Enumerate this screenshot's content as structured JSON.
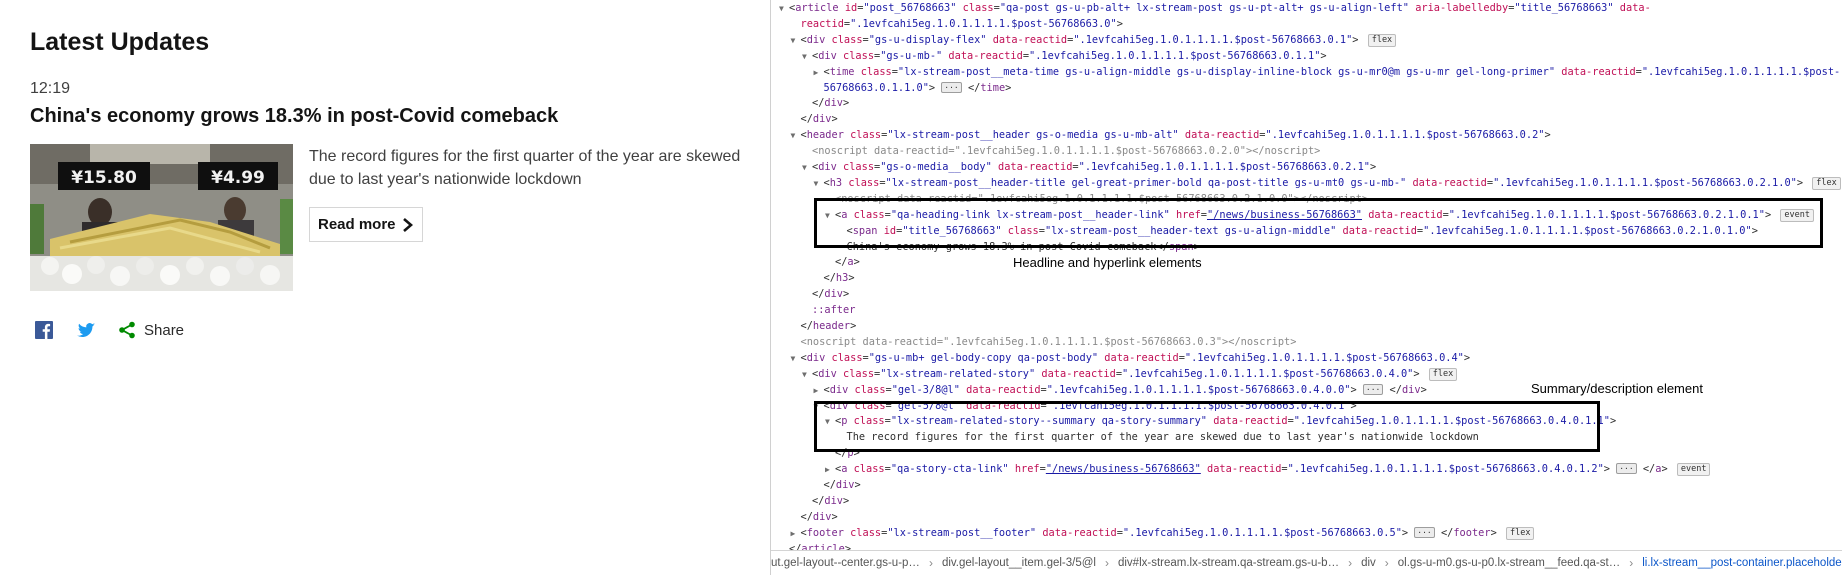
{
  "post": {
    "section_title": "Latest Updates",
    "time": "12:19",
    "headline": "China's economy grows 18.3% in post-Covid comeback",
    "summary": "The record figures for the first quarter of the year are skewed due to last year's nationwide lockdown",
    "read_more": "Read more",
    "image_signs": [
      "¥15.80",
      "¥4.99"
    ],
    "share": {
      "facebook_icon": "facebook-icon",
      "twitter_icon": "twitter-icon",
      "share_icon": "share-icon",
      "share_label": "Share"
    },
    "colors": {
      "facebook": "#3b5998",
      "twitter": "#1d9bf0",
      "share": "#008a00",
      "text": "#141414"
    }
  },
  "devtools": {
    "lines": [
      {
        "indent": 0,
        "tri": "open",
        "html": "&lt;<span class='tag'>article</span> <span class='an'>id</span>=<span class='av'>\"post_56768663\"</span> <span class='an'>class</span>=<span class='av'>\"qa-post gs-u-pb-alt+ lx-stream-post gs-u-pt-alt+ gs-u-align-left\"</span> <span class='an'>aria-labelledby</span>=<span class='av'>\"title_56768663\"</span> <span class='an'>data-</span>"
      },
      {
        "indent": 1,
        "tri": "none",
        "html": "<span class='an'>reactid</span>=<span class='av'>\".1evfcahi5eg.1.0.1.1.1.1.$post-56768663.0\"</span>&gt;"
      },
      {
        "indent": 1,
        "tri": "open",
        "html": "&lt;<span class='tag'>div</span> <span class='an'>class</span>=<span class='av'>\"gs-u-display-flex\"</span> <span class='an'>data-reactid</span>=<span class='av'>\".1evfcahi5eg.1.0.1.1.1.1.$post-56768663.0.1\"</span>&gt; <span class='badge'>flex</span>"
      },
      {
        "indent": 2,
        "tri": "open",
        "html": "&lt;<span class='tag'>div</span> <span class='an'>class</span>=<span class='av'>\"gs-u-mb-\"</span> <span class='an'>data-reactid</span>=<span class='av'>\".1evfcahi5eg.1.0.1.1.1.1.$post-56768663.0.1.1\"</span>&gt;"
      },
      {
        "indent": 3,
        "tri": "closed",
        "html": "&lt;<span class='tag'>time</span> <span class='an'>class</span>=<span class='av'>\"lx-stream-post__meta-time gs-u-align-middle gs-u-display-inline-block gs-u-mr0@m gs-u-mr gel-long-primer\"</span> <span class='an'>data-reactid</span>=<span class='av'>\".1evfcahi5eg.1.0.1.1.1.1.$post-</span>"
      },
      {
        "indent": 3,
        "tri": "none",
        "html": "<span class='av'>56768663.0.1.1.0\"</span>&gt; <span class='ell'>···</span> &lt;/<span class='tag'>time</span>&gt;"
      },
      {
        "indent": 2,
        "tri": "none",
        "html": "&lt;/<span class='tag'>div</span>&gt;"
      },
      {
        "indent": 1,
        "tri": "none",
        "html": "&lt;/<span class='tag'>div</span>&gt;"
      },
      {
        "indent": 1,
        "tri": "open",
        "html": "&lt;<span class='tag'>header</span> <span class='an'>class</span>=<span class='av'>\"lx-stream-post__header gs-o-media gs-u-mb-alt\"</span> <span class='an'>data-reactid</span>=<span class='av'>\".1evfcahi5eg.1.0.1.1.1.1.$post-56768663.0.2\"</span>&gt;"
      },
      {
        "indent": 2,
        "tri": "none",
        "html": "<span class='cm'>&lt;noscript data-reactid=\".1evfcahi5eg.1.0.1.1.1.1.$post-56768663.0.2.0\"&gt;&lt;/noscript&gt;</span>"
      },
      {
        "indent": 2,
        "tri": "open",
        "html": "&lt;<span class='tag'>div</span> <span class='an'>class</span>=<span class='av'>\"gs-o-media__body\"</span> <span class='an'>data-reactid</span>=<span class='av'>\".1evfcahi5eg.1.0.1.1.1.1.$post-56768663.0.2.1\"</span>&gt;"
      },
      {
        "indent": 3,
        "tri": "open",
        "html": "&lt;<span class='tag'>h3</span> <span class='an'>class</span>=<span class='av'>\"lx-stream-post__header-title gel-great-primer-bold qa-post-title gs-u-mt0 gs-u-mb-\"</span> <span class='an'>data-reactid</span>=<span class='av'>\".1evfcahi5eg.1.0.1.1.1.1.$post-56768663.0.2.1.0\"</span>&gt; <span class='badge'>flex</span>"
      },
      {
        "indent": 4,
        "tri": "none",
        "html": "<span class='cm'>&lt;noscript data-reactid=\".1evfcahi5eg.1.0.1.1.1.1.$post-56768663.0.2.1.0.0\"&gt;&lt;/noscript&gt;</span>"
      },
      {
        "indent": 4,
        "tri": "open",
        "html": "&lt;<span class='tag'>a</span> <span class='an'>class</span>=<span class='av'>\"qa-heading-link lx-stream-post__header-link\"</span> <span class='an'>href</span>=<span class='av lnk'>\"/news/business-56768663\"</span> <span class='an'>data-reactid</span>=<span class='av'>\".1evfcahi5eg.1.0.1.1.1.1.$post-56768663.0.2.1.0.1\"</span>&gt; <span class='badge'>event</span>"
      },
      {
        "indent": 5,
        "tri": "none",
        "html": "&lt;<span class='tag'>span</span> <span class='an'>id</span>=<span class='av'>\"title_56768663\"</span> <span class='an'>class</span>=<span class='av'>\"lx-stream-post__header-text gs-u-align-middle\"</span> <span class='an'>data-reactid</span>=<span class='av'>\".1evfcahi5eg.1.0.1.1.1.1.$post-56768663.0.2.1.0.1.0\"</span>&gt;"
      },
      {
        "indent": 5,
        "tri": "none",
        "html": "<span class='tx'>China's economy grows 18.3% in post-Covid comeback</span>&lt;/<span class='tag'>span</span>&gt;"
      },
      {
        "indent": 4,
        "tri": "none",
        "html": "&lt;/<span class='tag'>a</span>&gt;"
      },
      {
        "indent": 3,
        "tri": "none",
        "html": "&lt;/<span class='tag'>h3</span>&gt;"
      },
      {
        "indent": 2,
        "tri": "none",
        "html": "&lt;/<span class='tag'>div</span>&gt;"
      },
      {
        "indent": 2,
        "tri": "none",
        "html": "<span class='tag'>::after</span>"
      },
      {
        "indent": 1,
        "tri": "none",
        "html": "&lt;/<span class='tag'>header</span>&gt;"
      },
      {
        "indent": 1,
        "tri": "none",
        "html": "<span class='cm'>&lt;noscript data-reactid=\".1evfcahi5eg.1.0.1.1.1.1.$post-56768663.0.3\"&gt;&lt;/noscript&gt;</span>"
      },
      {
        "indent": 1,
        "tri": "open",
        "html": "&lt;<span class='tag'>div</span> <span class='an'>class</span>=<span class='av'>\"gs-u-mb+ gel-body-copy qa-post-body\"</span> <span class='an'>data-reactid</span>=<span class='av'>\".1evfcahi5eg.1.0.1.1.1.1.$post-56768663.0.4\"</span>&gt;"
      },
      {
        "indent": 2,
        "tri": "open",
        "html": "&lt;<span class='tag'>div</span> <span class='an'>class</span>=<span class='av'>\"lx-stream-related-story\"</span> <span class='an'>data-reactid</span>=<span class='av'>\".1evfcahi5eg.1.0.1.1.1.1.$post-56768663.0.4.0\"</span>&gt; <span class='badge'>flex</span>"
      },
      {
        "indent": 3,
        "tri": "closed",
        "html": "&lt;<span class='tag'>div</span> <span class='an'>class</span>=<span class='av'>\"gel-3/8@l\"</span> <span class='an'>data-reactid</span>=<span class='av'>\".1evfcahi5eg.1.0.1.1.1.1.$post-56768663.0.4.0.0\"</span>&gt; <span class='ell'>···</span> &lt;/<span class='tag'>div</span>&gt;"
      },
      {
        "indent": 3,
        "tri": "open",
        "html": "&lt;<span class='tag'>div</span> <span class='an'>class</span>=<span class='av'>\"gel-5/8@l\"</span> <span class='an'>data-reactid</span>=<span class='av'>\".1evfcahi5eg.1.0.1.1.1.1.$post-56768663.0.4.0.1\"</span>&gt;"
      },
      {
        "indent": 4,
        "tri": "open",
        "html": "&lt;<span class='tag'>p</span> <span class='an'>class</span>=<span class='av'>\"lx-stream-related-story--summary qa-story-summary\"</span> <span class='an'>data-reactid</span>=<span class='av'>\".1evfcahi5eg.1.0.1.1.1.1.$post-56768663.0.4.0.1.1\"</span>&gt;"
      },
      {
        "indent": 5,
        "tri": "none",
        "html": "<span class='tx'>The record figures for the first quarter of the year are skewed due to last year's nationwide lockdown</span>"
      },
      {
        "indent": 4,
        "tri": "none",
        "html": "&lt;/<span class='tag'>p</span>&gt;"
      },
      {
        "indent": 4,
        "tri": "closed",
        "html": "&lt;<span class='tag'>a</span> <span class='an'>class</span>=<span class='av'>\"qa-story-cta-link\"</span> <span class='an'>href</span>=<span class='av lnk'>\"/news/business-56768663\"</span> <span class='an'>data-reactid</span>=<span class='av'>\".1evfcahi5eg.1.0.1.1.1.1.$post-56768663.0.4.0.1.2\"</span>&gt; <span class='ell'>···</span> &lt;/<span class='tag'>a</span>&gt; <span class='badge'>event</span>"
      },
      {
        "indent": 3,
        "tri": "none",
        "html": "&lt;/<span class='tag'>div</span>&gt;"
      },
      {
        "indent": 2,
        "tri": "none",
        "html": "&lt;/<span class='tag'>div</span>&gt;"
      },
      {
        "indent": 1,
        "tri": "none",
        "html": "&lt;/<span class='tag'>div</span>&gt;"
      },
      {
        "indent": 1,
        "tri": "closed",
        "html": "&lt;<span class='tag'>footer</span> <span class='an'>class</span>=<span class='av'>\"lx-stream-post__footer\"</span> <span class='an'>data-reactid</span>=<span class='av'>\".1evfcahi5eg.1.0.1.1.1.1.$post-56768663.0.5\"</span>&gt; <span class='ell'>···</span> &lt;/<span class='tag'>footer</span>&gt; <span class='badge'>flex</span>"
      },
      {
        "indent": 0,
        "tri": "none",
        "html": "&lt;/<span class='tag'>article</span>&gt;"
      }
    ],
    "annotations": {
      "headline_label": "Headline and hyperlink elements",
      "summary_label": "Summary/description element"
    },
    "breadcrumbs": [
      {
        "tag": "",
        "cls": "ut.gel-layout--center.gs-u-p…",
        "selected": false
      },
      {
        "tag": "div",
        "cls": ".gel-layout__item.gel-3/5@l",
        "selected": false
      },
      {
        "tag": "div",
        "cls": "#lx-stream.lx-stream.qa-stream.gs-u-b…",
        "selected": false
      },
      {
        "tag": "div",
        "cls": "",
        "selected": false
      },
      {
        "tag": "ol",
        "cls": ".gs-u-m0.gs-u-p0.lx-stream__feed.qa-st…",
        "selected": false
      },
      {
        "tag": "li",
        "cls": ".lx-stream__post-container.placeholder…",
        "selected": true
      }
    ]
  }
}
